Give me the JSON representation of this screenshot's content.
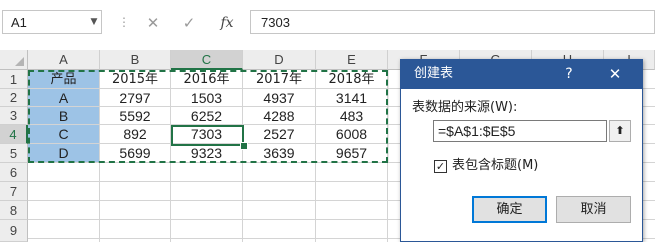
{
  "formula_bar": {
    "name_box": "A1",
    "cancel_icon": "✕",
    "enter_icon": "✓",
    "fx_label": "fx",
    "formula": "7303"
  },
  "columns": [
    "A",
    "B",
    "C",
    "D",
    "E",
    "F",
    "G",
    "H",
    "I"
  ],
  "rows": [
    "1",
    "2",
    "3",
    "4",
    "5",
    "6",
    "7",
    "8",
    "9"
  ],
  "table": {
    "headers": [
      "产品",
      "2015年",
      "2016年",
      "2017年",
      "2018年"
    ],
    "data": [
      [
        "A",
        "2797",
        "1503",
        "4937",
        "3141"
      ],
      [
        "B",
        "5592",
        "6252",
        "4288",
        "483"
      ],
      [
        "C",
        "892",
        "7303",
        "2527",
        "6008"
      ],
      [
        "D",
        "5699",
        "9323",
        "3639",
        "9657"
      ]
    ]
  },
  "dialog": {
    "title": "创建表",
    "help": "?",
    "close": "✕",
    "source_label": "表数据的来源(W):",
    "range_value": "=$A$1:$E$5",
    "range_button": "⬆",
    "has_headers_checked": "✓",
    "has_headers_label": "表包含标题(M)",
    "ok": "确定",
    "cancel": "取消"
  },
  "colors": {
    "accent": "#217346",
    "table_fill": "#9dc3e6",
    "dialog_title": "#2b5797"
  }
}
